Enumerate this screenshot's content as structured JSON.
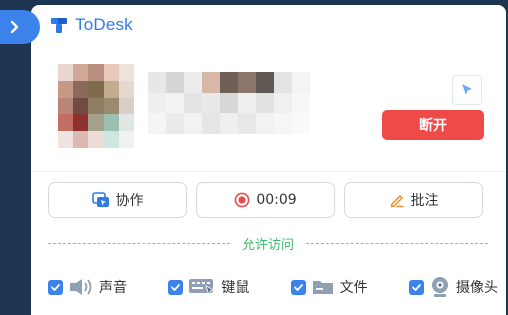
{
  "window": {
    "title": "ToDesk",
    "accent_color": "#2f7be6",
    "collapse_icon": "chevron-right-icon"
  },
  "session": {
    "disconnect_label": "断开",
    "disconnect_color": "#ef4a47",
    "pointer_icon": "cursor-icon",
    "avatar_colors": [
      [
        "#e8d6cf",
        "#cfa995",
        "#b99080",
        "#e7c8b9",
        "#efe2dc"
      ],
      [
        "#c69a86",
        "#8a6a5c",
        "#7e6a4f",
        "#c1ad8c",
        "#e5d9cf"
      ],
      [
        "#b98576",
        "#6f4b41",
        "#8f7c64",
        "#9a8a6e",
        "#d9cfc5"
      ],
      [
        "#c26e64",
        "#8e3230",
        "#a3a18c",
        "#9bc0b2",
        "#e0e6e2"
      ],
      [
        "#f1e3df",
        "#d9b9b2",
        "#ecdcd7",
        "#cde6df",
        "#eef2f0"
      ]
    ],
    "name_colors": [
      [
        "#e7e7e7",
        "#d6d6d6",
        "#ececec",
        "#d7b7a5",
        "#6d5f55",
        "#8b766a",
        "#5e5753",
        "#e3e3e3",
        "#f4f4f4"
      ],
      [
        "#efefef",
        "#f3f3f3",
        "#e4e4e4",
        "#e9e9e9",
        "#d7d7d7",
        "#eeeeee",
        "#e2e2e2",
        "#f0f0f0",
        "#f7f7f7"
      ],
      [
        "#f5f5f5",
        "#eaeaea",
        "#f2f2f2",
        "#e6e6e6",
        "#efefef",
        "#e8e8e8",
        "#f2f2f2",
        "#f6f6f6",
        "#fafafa"
      ]
    ]
  },
  "actions": [
    {
      "label": "协作",
      "icon": "collaborate-icon"
    },
    {
      "label": "00:09",
      "icon": "record-icon"
    },
    {
      "label": "批注",
      "icon": "annotate-pen-icon"
    }
  ],
  "permissions": {
    "title": "允许访问",
    "items": [
      {
        "label": "声音",
        "icon": "speaker-icon",
        "checked": true
      },
      {
        "label": "键鼠",
        "icon": "keyboard-mouse-icon",
        "checked": true
      },
      {
        "label": "文件",
        "icon": "folder-icon",
        "checked": true
      },
      {
        "label": "摄像头",
        "icon": "camera-icon",
        "checked": true
      }
    ]
  }
}
